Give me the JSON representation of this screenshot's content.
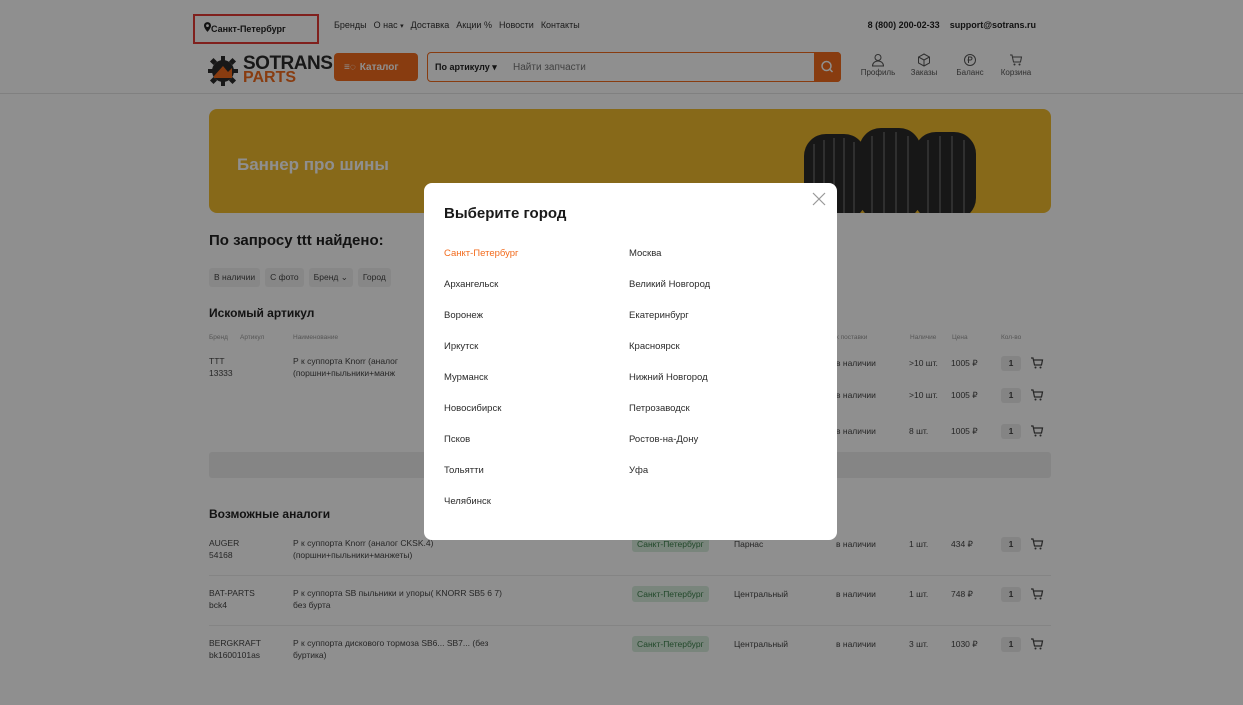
{
  "topbar": {
    "city": "Санкт-Петербург",
    "nav": [
      "Бренды",
      "О нас",
      "Доставка",
      "Акции",
      "Новости",
      "Контакты"
    ],
    "phone": "8 (800) 200-02-33",
    "email": "support@sotrans.ru"
  },
  "header": {
    "logo_top": "SOTRANS",
    "logo_bottom": "PARTS",
    "catalog_label": "Каталог",
    "search_mode": "По артикулу",
    "search_placeholder": "Найти запчасти",
    "icons": [
      "Профиль",
      "Заказы",
      "Баланс",
      "Корзина"
    ]
  },
  "banner": {
    "title": "Баннер про шины"
  },
  "results": {
    "title": "По запросу ttt найдено:",
    "filters": [
      "В наличии",
      "С фото",
      "Бренд",
      "Город"
    ],
    "searched_title": "Искомый артикул",
    "columns": [
      "Бренд",
      "Артикул",
      "Наименование",
      "Срок поставки",
      "Наличие",
      "Цена",
      "Кол-во"
    ],
    "main": {
      "brand": "TTT",
      "article": "13333",
      "name_1": "Р к суппорта Knorr (аналог",
      "name_2": "(поршни+пыльники+манж",
      "offers": [
        {
          "term": "в наличии",
          "stock": ">10 шт.",
          "price": "1005 ₽",
          "qty": "1"
        },
        {
          "term": "в наличии",
          "stock": ">10 шт.",
          "price": "1005 ₽",
          "qty": "1"
        },
        {
          "term": "в наличии",
          "stock": "8 шт.",
          "price": "1005 ₽",
          "qty": "1"
        }
      ]
    },
    "analogs_title": "Возможные аналоги",
    "analogs": [
      {
        "brand": "AUGER",
        "article": "54168",
        "name_1": "Р к суппорта Knorr (аналог CKSK.4)",
        "name_2": "(поршни+пыльники+манжеты)",
        "city": "Санкт-Петербург",
        "warehouse": "Парнас",
        "term": "в наличии",
        "stock": "1 шт.",
        "price": "434 ₽",
        "qty": "1"
      },
      {
        "brand": "BAT-PARTS",
        "article": "bck4",
        "name_1": "Р к суппорта SB пыльники и упоры( KNORR SB5 6 7)",
        "name_2": "без бурта",
        "city": "Санкт-Петербург",
        "warehouse": "Центральный",
        "term": "в наличии",
        "stock": "1 шт.",
        "price": "748 ₽",
        "qty": "1"
      },
      {
        "brand": "BERGKRAFT",
        "article": "bk1600101as",
        "name_1": "Р к суппорта дискового тормоза SB6... SB7... (без",
        "name_2": "буртика)",
        "city": "Санкт-Петербург",
        "warehouse": "Центральный",
        "term": "в наличии",
        "stock": "3 шт.",
        "price": "1030 ₽",
        "qty": "1"
      }
    ]
  },
  "modal": {
    "title": "Выберите город",
    "active_city": "Санкт-Петербург",
    "cities_left": [
      "Санкт-Петербург",
      "Архангельск",
      "Воронеж",
      "Иркутск",
      "Мурманск",
      "Новосибирск",
      "Псков",
      "Тольятти",
      "Челябинск"
    ],
    "cities_right": [
      "Москва",
      "Великий Новгород",
      "Екатеринбург",
      "Красноярск",
      "Нижний Новгород",
      "Петрозаводск",
      "Ростов-на-Дону",
      "Уфа"
    ]
  },
  "colors": {
    "accent": "#f26b1d",
    "highlight": "#e53935",
    "banner": "#f0bb2e"
  }
}
